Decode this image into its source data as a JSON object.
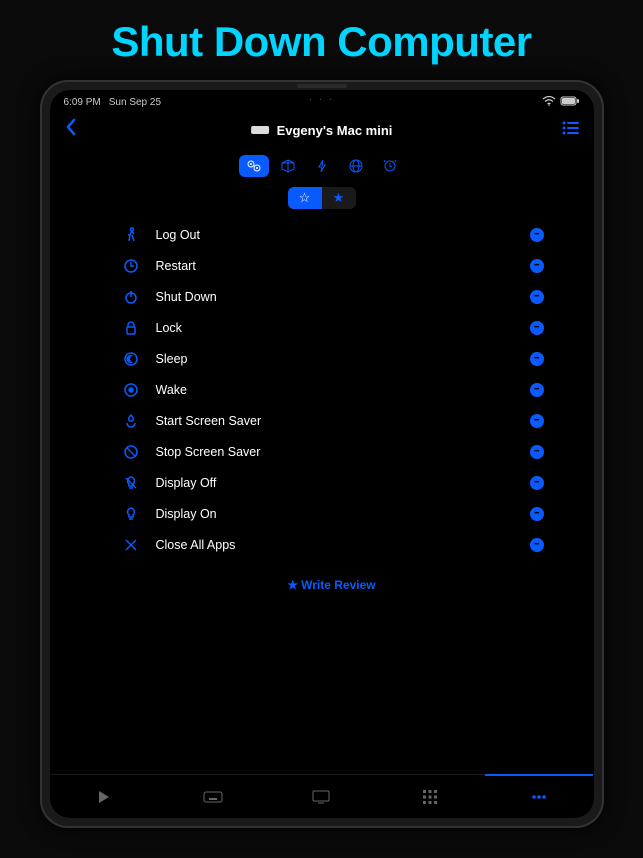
{
  "hero": {
    "title": "Shut Down Computer"
  },
  "status": {
    "time": "6:09 PM",
    "date": "Sun Sep 25",
    "home_dots": "· · ·"
  },
  "header": {
    "device_name": "Evgeny's Mac mini"
  },
  "filters": [
    {
      "name": "gears",
      "active": true
    },
    {
      "name": "cube",
      "active": false
    },
    {
      "name": "bolt",
      "active": false
    },
    {
      "name": "globe",
      "active": false
    },
    {
      "name": "clock",
      "active": false
    }
  ],
  "star_segment": [
    {
      "name": "star-outline",
      "active": true,
      "glyph": "☆"
    },
    {
      "name": "star-filled",
      "active": false,
      "glyph": "★"
    }
  ],
  "actions": [
    {
      "icon": "person-walk",
      "label": "Log Out"
    },
    {
      "icon": "arrow-circle",
      "label": "Restart"
    },
    {
      "icon": "power",
      "label": "Shut Down"
    },
    {
      "icon": "lock",
      "label": "Lock"
    },
    {
      "icon": "moon-circle",
      "label": "Sleep"
    },
    {
      "icon": "sun-circle",
      "label": "Wake"
    },
    {
      "icon": "fire-timer",
      "label": "Start Screen Saver"
    },
    {
      "icon": "cancel-circle",
      "label": "Stop Screen Saver"
    },
    {
      "icon": "bulb-off",
      "label": "Display Off"
    },
    {
      "icon": "bulb-on",
      "label": "Display On"
    },
    {
      "icon": "close-x",
      "label": "Close All Apps"
    }
  ],
  "review": {
    "label": "Write Review",
    "star": "★"
  },
  "tabs": [
    {
      "name": "play",
      "active": false
    },
    {
      "name": "keyboard",
      "active": false
    },
    {
      "name": "display",
      "active": false
    },
    {
      "name": "grid",
      "active": false
    },
    {
      "name": "more",
      "active": true
    }
  ],
  "colors": {
    "accent": "#0a5bff",
    "hero": "#00d4ff"
  }
}
